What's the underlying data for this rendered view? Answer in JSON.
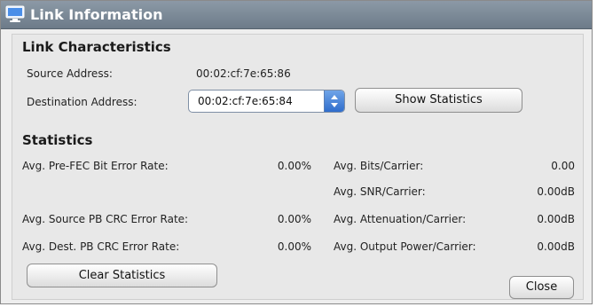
{
  "window": {
    "title": "Link Information",
    "icon": "monitor-icon",
    "accent": "#2f6dcc"
  },
  "link": {
    "heading": "Link Characteristics",
    "source_label": "Source Address:",
    "source_value": "00:02:cf:7e:65:86",
    "dest_label": "Destination Address:",
    "dest_value": "00:02:cf:7e:65:84",
    "show_stats_label": "Show Statistics"
  },
  "stats": {
    "heading": "Statistics",
    "left": [
      {
        "label": "Avg. Pre-FEC Bit Error Rate:",
        "value": "0.00%"
      },
      {
        "label": "Avg. Source PB CRC Error Rate:",
        "value": "0.00%"
      },
      {
        "label": "Avg. Dest. PB CRC Error Rate:",
        "value": "0.00%"
      }
    ],
    "right": [
      {
        "label": "Avg. Bits/Carrier:",
        "value": "0.00"
      },
      {
        "label": "Avg. SNR/Carrier:",
        "value": "0.00dB"
      },
      {
        "label": "Avg. Attenuation/Carrier:",
        "value": "0.00dB"
      },
      {
        "label": "Avg. Output Power/Carrier:",
        "value": "0.00dB"
      }
    ],
    "clear_label": "Clear Statistics"
  },
  "footer": {
    "close_label": "Close"
  }
}
